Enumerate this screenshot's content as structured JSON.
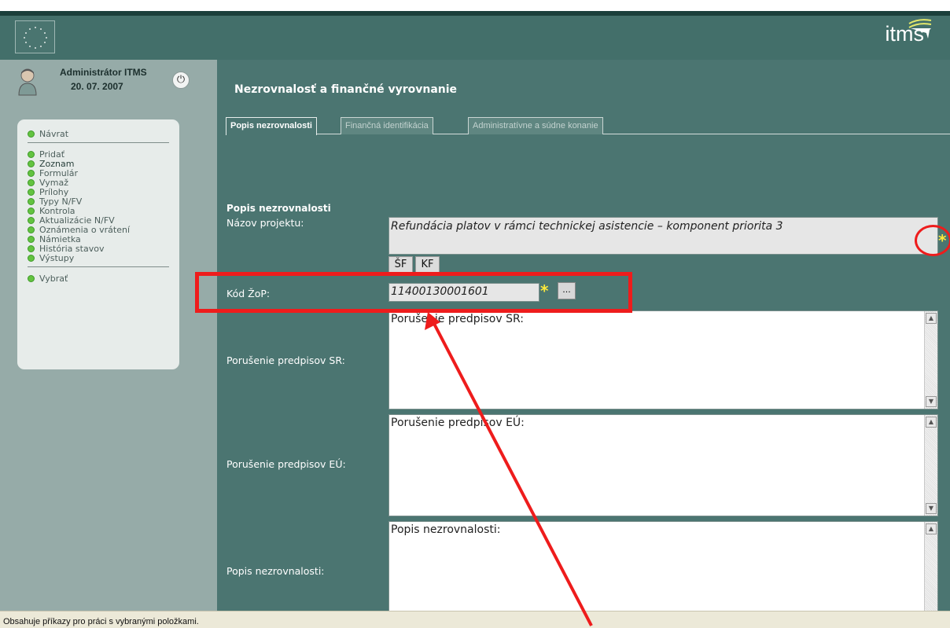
{
  "header": {
    "brand": "itms"
  },
  "user": {
    "name": "Administrátor ITMS",
    "date": "20. 07. 2007"
  },
  "sidebar": {
    "return_label": "Návrat",
    "items": [
      {
        "label": "Pridať"
      },
      {
        "label": "Zoznam"
      },
      {
        "label": "Formulár"
      },
      {
        "label": "Vymaž"
      },
      {
        "label": "Prílohy"
      },
      {
        "label": "Typy N/FV"
      },
      {
        "label": "Kontrola"
      },
      {
        "label": "Aktualizácie N/FV"
      },
      {
        "label": "Oznámenia o vrátení"
      },
      {
        "label": "Námietka"
      },
      {
        "label": "História stavov"
      },
      {
        "label": "Výstupy"
      }
    ],
    "select_label": "Vybrať"
  },
  "main": {
    "title": "Nezrovnalosť a finančné vyrovnanie",
    "tabs": [
      {
        "label": "Popis nezrovnalosti",
        "active": true
      },
      {
        "label": "Finančná identifikácia",
        "active": false
      },
      {
        "label": "Administratívne a súdne konanie",
        "active": false
      }
    ],
    "section_title": "Popis nezrovnalosti",
    "project": {
      "label": "Názov projektu:",
      "value": "Refundácia platov v rámci technickej asistencie – komponent priorita 3",
      "required_mark": "*",
      "btn_sf": "ŠF",
      "btn_kf": "KF"
    },
    "zop": {
      "label": "Kód ŽoP:",
      "value": "11400130001601",
      "required_mark": "*",
      "browse_btn": "..."
    },
    "sr": {
      "label": "Porušenie predpisov SR:",
      "value": "Porušenie predpisov SR:"
    },
    "eu": {
      "label": "Porušenie predpisov EÚ:",
      "value": "Porušenie predpisov EÚ:"
    },
    "desc": {
      "label": "Popis nezrovnalosti:",
      "value": "Popis nezrovnalosti:"
    }
  },
  "statusbar": {
    "text": "Obsahuje příkazy pro práci s vybranými položkami."
  },
  "colors": {
    "header_bg": "#436f6a",
    "main_bg": "#4b7571",
    "sidebar_bg": "#96aba8",
    "annotation": "#ee1c1c",
    "required": "#ffea3a"
  }
}
